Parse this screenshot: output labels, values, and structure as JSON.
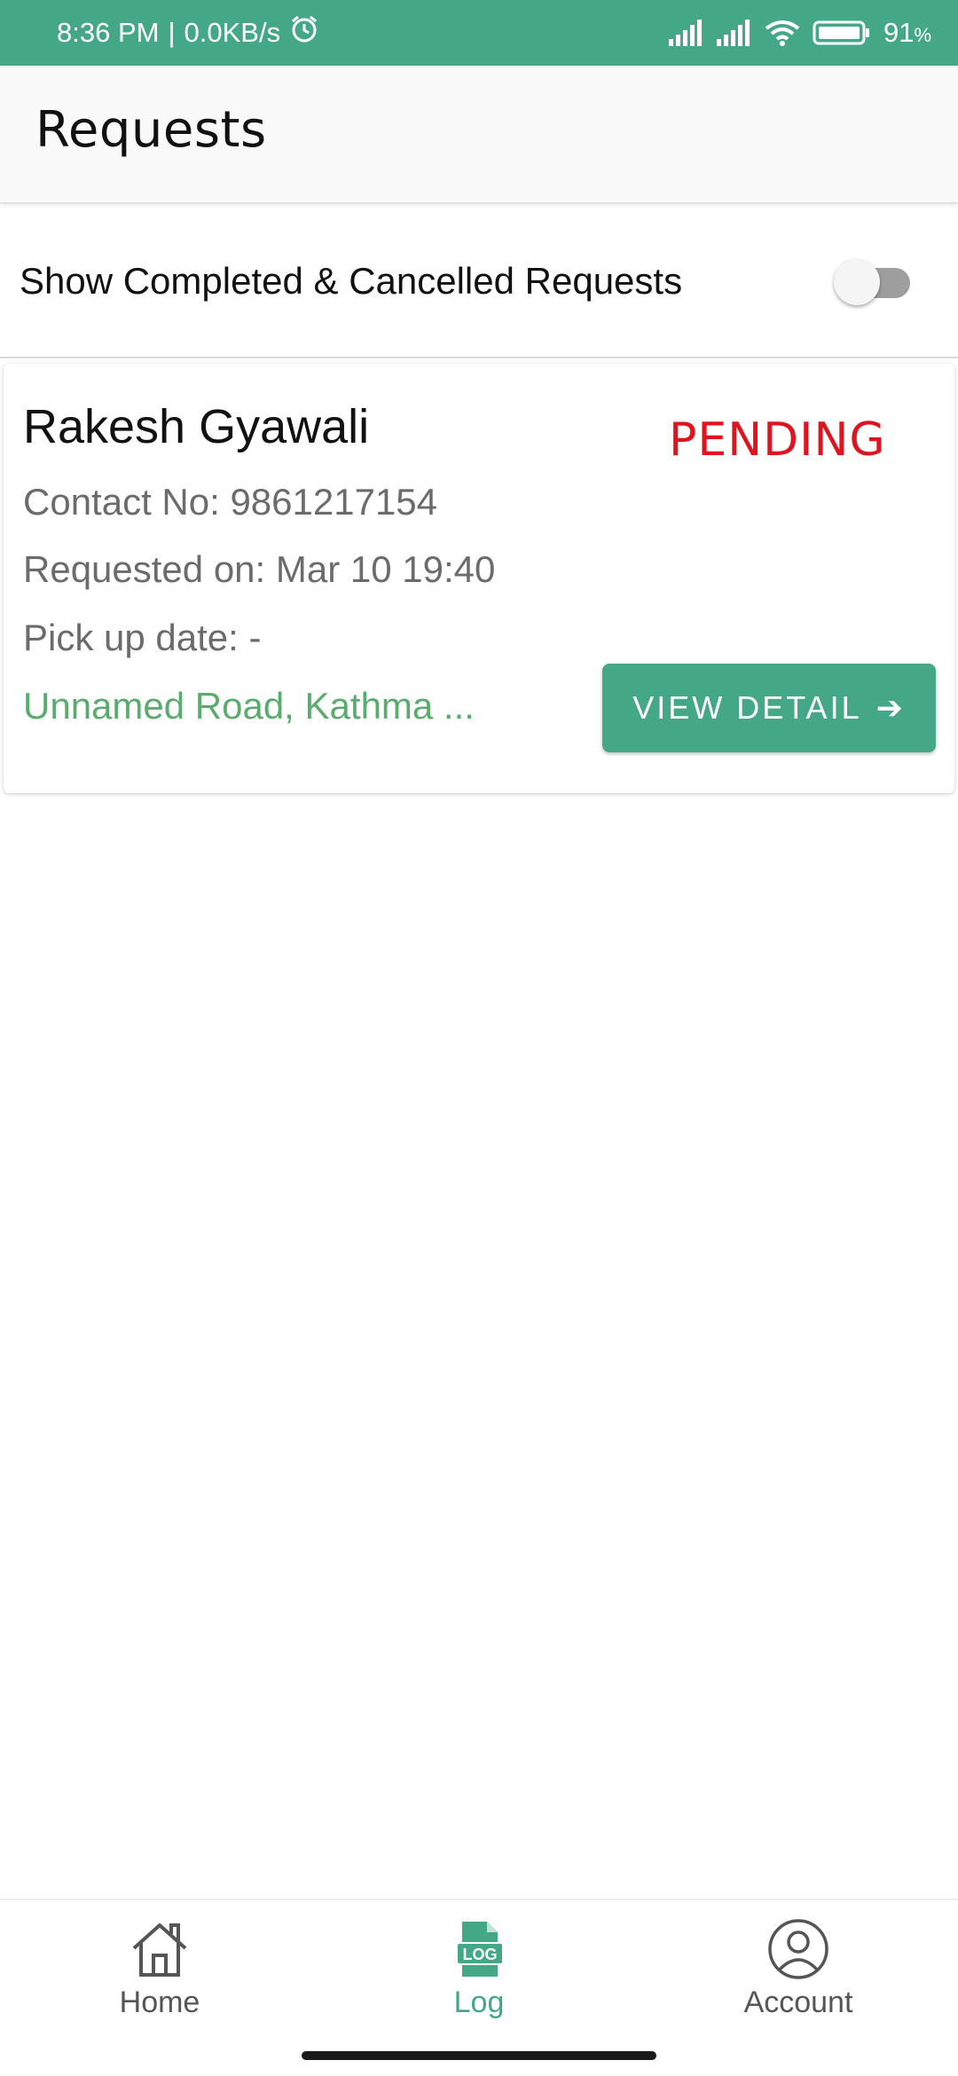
{
  "status_bar": {
    "time": "8:36 PM",
    "speed": "0.0KB/s",
    "battery": "91"
  },
  "app_bar": {
    "title": "Requests"
  },
  "filter": {
    "label": "Show Completed & Cancelled Requests",
    "enabled": false
  },
  "requests": [
    {
      "name": "Rakesh Gyawali",
      "status": "PENDING",
      "contact": "Contact No: 9861217154",
      "requested_on": "Requested on: Mar 10 19:40",
      "pickup_date": "Pick up date: -",
      "address": "Unnamed Road, Kathma ...",
      "button_label": "VIEW DETAIL",
      "button_arrow": "➔"
    }
  ],
  "bottom_nav": [
    {
      "label": "Home",
      "icon": "home-icon",
      "active": false
    },
    {
      "label": "Log",
      "icon": "log-icon",
      "active": true
    },
    {
      "label": "Account",
      "icon": "account-icon",
      "active": false
    }
  ],
  "colors": {
    "primary": "#44a887",
    "pending": "#e0141e",
    "address": "#5aab6e"
  }
}
